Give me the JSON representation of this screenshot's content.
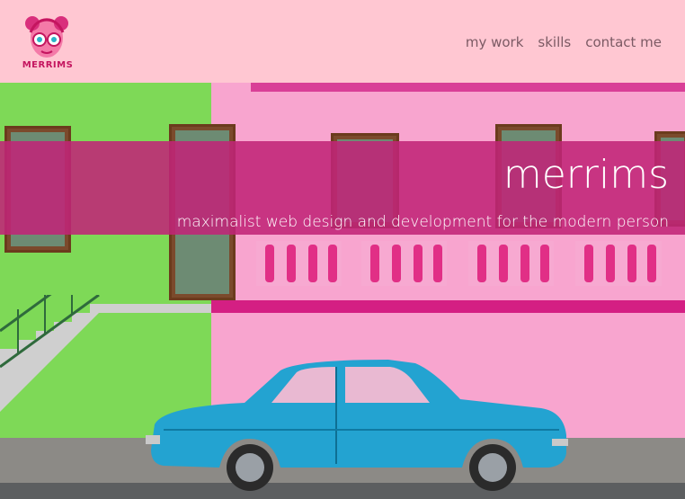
{
  "header": {
    "logo_text": "MERRIMS",
    "nav": [
      {
        "label": "my work"
      },
      {
        "label": "skills"
      },
      {
        "label": "contact me"
      }
    ]
  },
  "hero": {
    "title": "merrims",
    "subtitle": "maximalist web design and development for the modern person"
  },
  "colors": {
    "header_bg": "#ffc7d2",
    "banner": "#c02478",
    "accent": "#c4155f",
    "nav_text": "#7b5a64"
  }
}
